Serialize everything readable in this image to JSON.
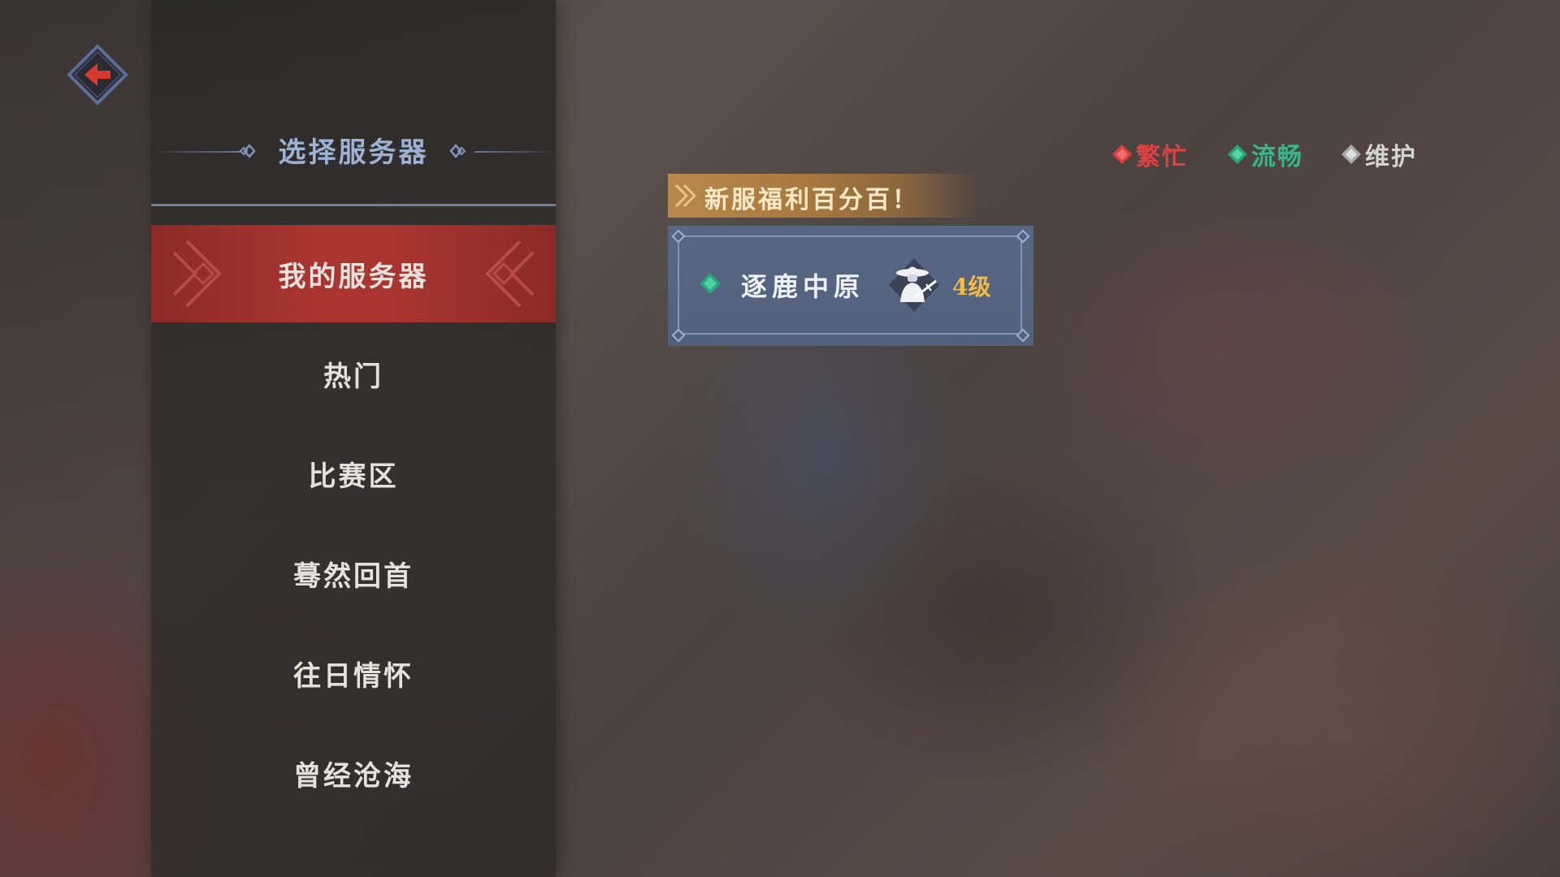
{
  "sidebar": {
    "title": "选择服务器",
    "items": [
      {
        "label": "我的服务器",
        "active": true
      },
      {
        "label": "热门",
        "active": false
      },
      {
        "label": "比赛区",
        "active": false
      },
      {
        "label": "蓦然回首",
        "active": false
      },
      {
        "label": "往日情怀",
        "active": false
      },
      {
        "label": "曾经沧海",
        "active": false
      }
    ]
  },
  "back_button": {
    "icon": "back-arrow-icon"
  },
  "legend": [
    {
      "label": "繁忙",
      "color": "#e0403f",
      "icon": "busy-diamond-icon"
    },
    {
      "label": "流畅",
      "color": "#34b88e",
      "icon": "smooth-diamond-icon"
    },
    {
      "label": "维护",
      "color": "#c9c9c9",
      "icon": "maintenance-diamond-icon"
    }
  ],
  "promo": {
    "label": "新服福利百分百！"
  },
  "server_card": {
    "name": "逐鹿中原",
    "level": "4级",
    "status_color": "#34b88e",
    "avatar_icon": "swordsman-avatar-icon"
  }
}
